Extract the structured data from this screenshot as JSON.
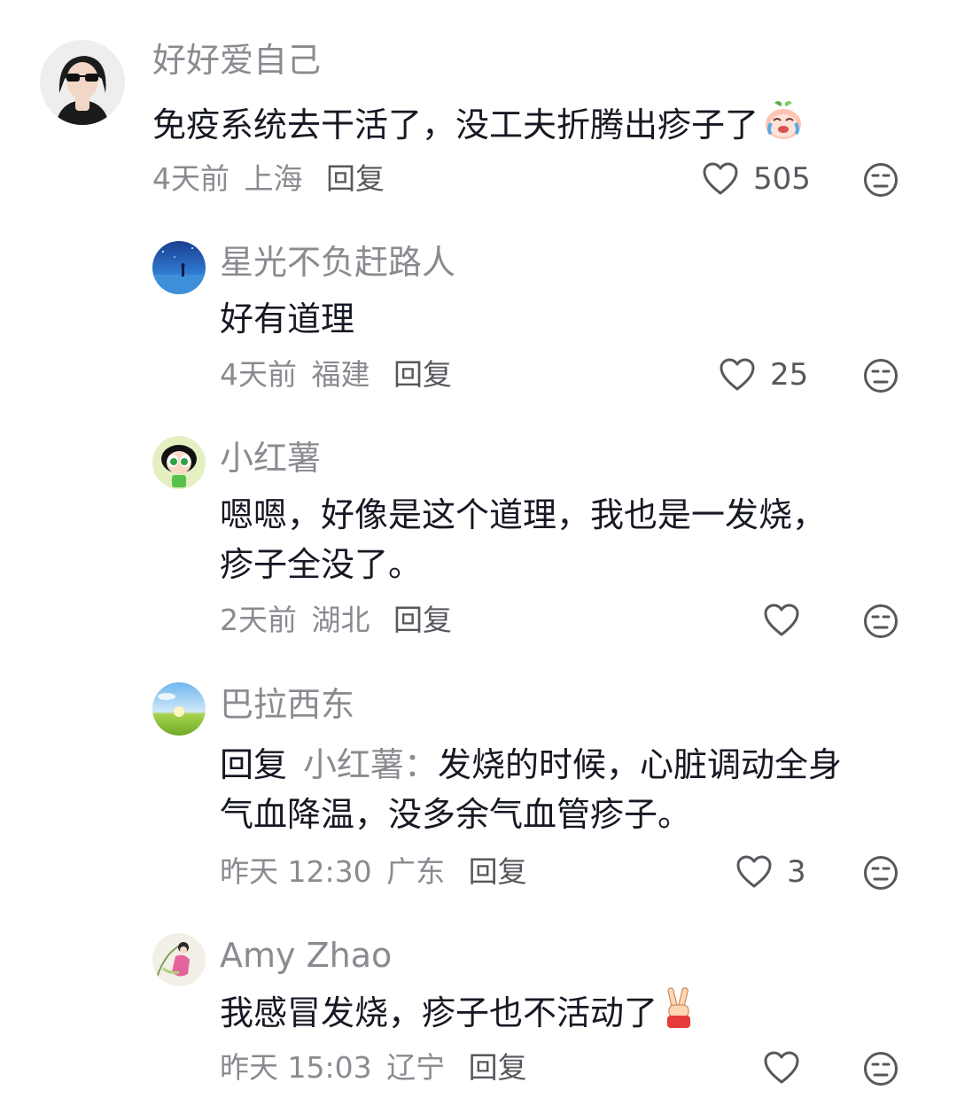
{
  "comments": [
    {
      "username": "好好爱自己",
      "text": "免疫系统去干活了，没工夫折腾出疹子了",
      "time": "4天前",
      "location": "上海",
      "reply_label": "回复",
      "likes": "505"
    },
    {
      "username": "星光不负赶路人",
      "text": "好有道理",
      "time": "4天前",
      "location": "福建",
      "reply_label": "回复",
      "likes": "25"
    },
    {
      "username": "小红薯",
      "text_line1": "嗯嗯，好像是这个道理，我也是一发烧，",
      "text_line2": "疹子全没了。",
      "time": "2天前",
      "location": "湖北",
      "reply_label": "回复",
      "likes": ""
    },
    {
      "username": "巴拉西东",
      "reply_prefix": "回复",
      "reply_to": "小红薯：",
      "text_line1": "发烧的时候，心脏调动全身",
      "text_line2": "气血降温，没多余气血管疹子。",
      "time": "昨天 12:30",
      "location": "广东",
      "reply_label": "回复",
      "likes": "3"
    },
    {
      "username": "Amy Zhao",
      "text": "我感冒发烧，疹子也不活动了",
      "time": "昨天 15:03",
      "location": "辽宁",
      "reply_label": "回复",
      "likes": ""
    }
  ],
  "icons": {
    "like": "heart-outline-icon",
    "dislike": "meh-face-icon",
    "emoji1": "crying-peach-emoji",
    "emoji2": "victory-hand-emoji"
  },
  "colors": {
    "text": "#161823",
    "muted": "#8a8b91",
    "icon": "#57585e"
  }
}
